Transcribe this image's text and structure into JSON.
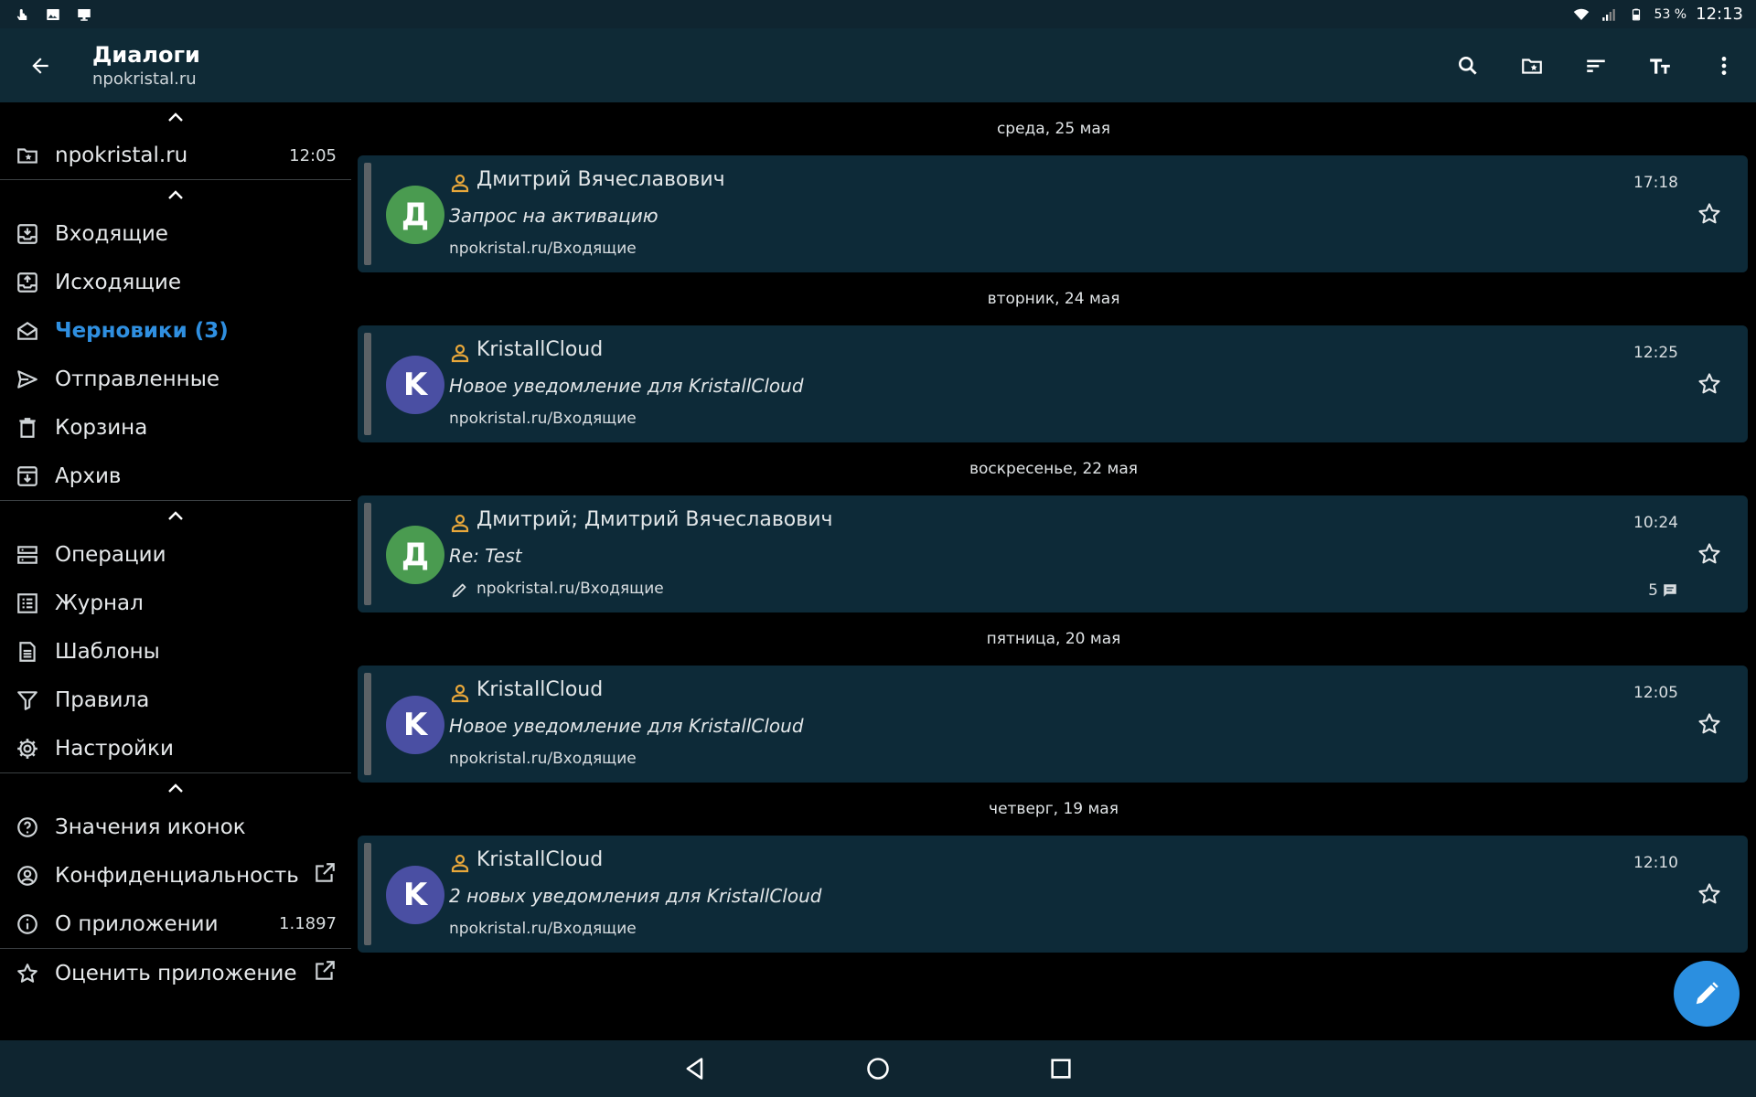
{
  "status_bar": {
    "battery_percent": "53 %",
    "time": "12:13"
  },
  "app_bar": {
    "title": "Диалоги",
    "subtitle": "npokristal.ru"
  },
  "sidebar": {
    "account": {
      "label": "npokristal.ru",
      "time": "12:05"
    },
    "folders": [
      {
        "label": "Входящие",
        "icon": "inbox-icon"
      },
      {
        "label": "Исходящие",
        "icon": "outbox-icon"
      },
      {
        "label": "Черновики (3)",
        "icon": "drafts-icon",
        "active": true
      },
      {
        "label": "Отправленные",
        "icon": "send-icon"
      },
      {
        "label": "Корзина",
        "icon": "trash-icon"
      },
      {
        "label": "Архив",
        "icon": "archive-icon"
      }
    ],
    "tools": [
      {
        "label": "Операции",
        "icon": "operations-icon"
      },
      {
        "label": "Журнал",
        "icon": "log-icon"
      },
      {
        "label": "Шаблоны",
        "icon": "templates-icon"
      },
      {
        "label": "Правила",
        "icon": "filter-icon"
      },
      {
        "label": "Настройки",
        "icon": "gear-icon"
      }
    ],
    "info": [
      {
        "label": "Значения иконок",
        "icon": "help-icon"
      },
      {
        "label": "Конфиденциальность",
        "icon": "privacy-icon"
      },
      {
        "label": "О приложении",
        "icon": "info-icon",
        "right": "1.1897"
      },
      {
        "label": "Оценить приложение",
        "icon": "star-outline-icon"
      }
    ]
  },
  "messages": [
    {
      "date": "среда, 25 мая",
      "initial": "Д",
      "avatar_color": "#4a9b50",
      "from": "Дмитрий Вячеславович",
      "subject": "Запрос на активацию",
      "folder": "npokristal.ru/Входящие",
      "time": "17:18"
    },
    {
      "date": "вторник, 24 мая",
      "initial": "K",
      "avatar_color": "#4a4fa3",
      "from": "KristallCloud",
      "subject": "Новое уведомление для KristallCloud",
      "folder": "npokristal.ru/Входящие",
      "time": "12:25"
    },
    {
      "date": "воскресенье, 22 мая",
      "initial": "Д",
      "avatar_color": "#4a9b50",
      "from": "Дмитрий; Дмитрий Вячеславович",
      "subject": "Re: Test",
      "folder": "npokristal.ru/Входящие",
      "time": "10:24",
      "count": "5",
      "has_draft": true
    },
    {
      "date": "пятница, 20 мая",
      "initial": "K",
      "avatar_color": "#4a4fa3",
      "from": "KristallCloud",
      "subject": "Новое уведомление для KristallCloud",
      "folder": "npokristal.ru/Входящие",
      "time": "12:05"
    },
    {
      "date": "четверг, 19 мая",
      "initial": "K",
      "avatar_color": "#4a4fa3",
      "from": "KristallCloud",
      "subject": "2 новых уведомления для KristallCloud",
      "folder": "npokristal.ru/Входящие",
      "time": "12:10"
    }
  ],
  "colors": {
    "accent": "#2f8fe0",
    "app_bar": "#0f2a36",
    "card": "#0d2a38",
    "person_icon": "#e8a73a"
  }
}
